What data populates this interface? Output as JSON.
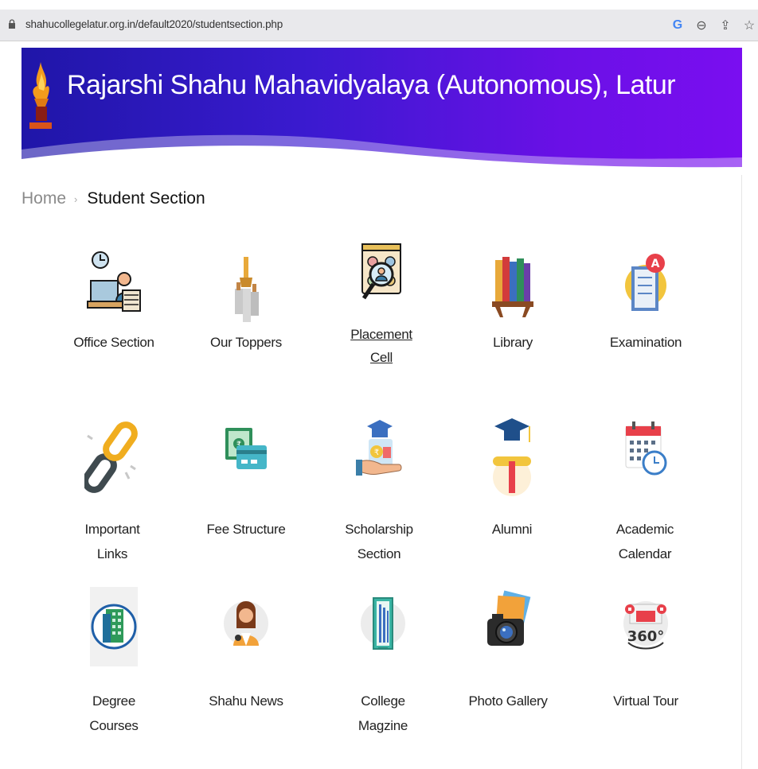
{
  "browser": {
    "url": "shahucollegelatur.org.in/default2020/studentsection.php",
    "icons": [
      "google-icon",
      "zoom-icon",
      "share-icon",
      "star-icon"
    ]
  },
  "header": {
    "title": "Rajarshi Shahu Mahavidyalaya (Autonomous), Latur",
    "colors": {
      "start": "#1f16a8",
      "end": "#7a0ef0"
    }
  },
  "breadcrumb": {
    "home": "Home",
    "separator": "›",
    "current": "Student Section"
  },
  "tiles": [
    {
      "label_line1": "Office Section",
      "label_line2": "",
      "icon": "office-section-icon",
      "link": false
    },
    {
      "label_line1": "Our Toppers",
      "label_line2": "",
      "icon": "toppers-icon",
      "link": false
    },
    {
      "label_line1": "Placement",
      "label_line2": "Cell",
      "icon": "placement-cell-icon",
      "link": true
    },
    {
      "label_line1": "Library",
      "label_line2": "",
      "icon": "library-icon",
      "link": false
    },
    {
      "label_line1": "Examination",
      "label_line2": "",
      "icon": "examination-icon",
      "link": false
    },
    {
      "label_line1": "Important",
      "label_line2": "Links",
      "icon": "important-links-icon",
      "link": false
    },
    {
      "label_line1": "Fee Structure",
      "label_line2": "",
      "icon": "fee-structure-icon",
      "link": false
    },
    {
      "label_line1": "Scholarship",
      "label_line2": "Section",
      "icon": "scholarship-icon",
      "link": false
    },
    {
      "label_line1": "Alumni",
      "label_line2": "",
      "icon": "alumni-icon",
      "link": false
    },
    {
      "label_line1": "Academic",
      "label_line2": "Calendar",
      "icon": "academic-calendar-icon",
      "link": false
    },
    {
      "label_line1": "Degree",
      "label_line2": "Courses",
      "icon": "degree-courses-icon",
      "link": false
    },
    {
      "label_line1": "Shahu News",
      "label_line2": "",
      "icon": "news-icon",
      "link": false
    },
    {
      "label_line1": "College",
      "label_line2": "Magzine",
      "icon": "magazine-icon",
      "link": false
    },
    {
      "label_line1": "Photo Gallery",
      "label_line2": "",
      "icon": "photo-gallery-icon",
      "link": false
    },
    {
      "label_line1": "Virtual Tour",
      "label_line2": "",
      "icon": "virtual-tour-icon",
      "link": false
    }
  ]
}
